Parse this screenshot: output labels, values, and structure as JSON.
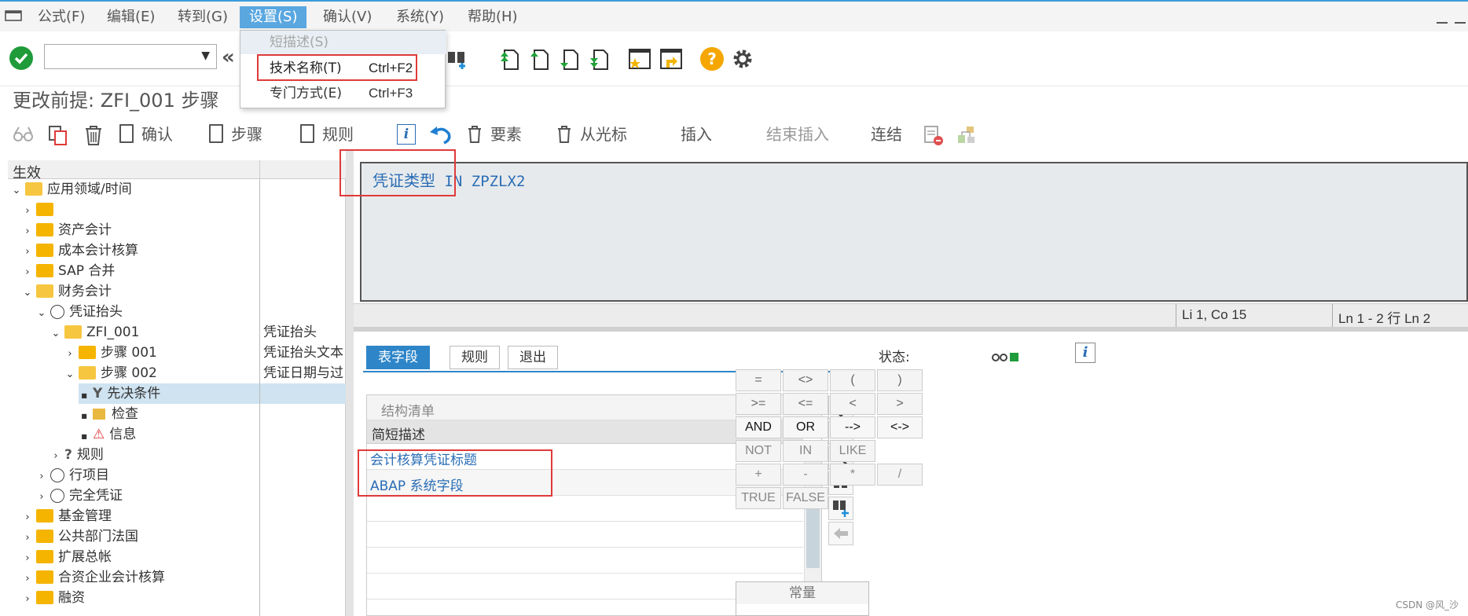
{
  "menubar": {
    "items": [
      {
        "label": "公式(F)"
      },
      {
        "label": "编辑(E)"
      },
      {
        "label": "转到(G)"
      },
      {
        "label": "设置(S)"
      },
      {
        "label": "确认(V)"
      },
      {
        "label": "系统(Y)"
      },
      {
        "label": "帮助(H)"
      }
    ]
  },
  "settings_menu": {
    "items": [
      {
        "label": "短描述(S)",
        "shortcut": ""
      },
      {
        "label": "技术名称(T)",
        "shortcut": "Ctrl+F2"
      },
      {
        "label": "专门方式(E)",
        "shortcut": "Ctrl+F3"
      }
    ]
  },
  "page": {
    "title": "更改前提: ZFI_001 步骤"
  },
  "app_toolbar": {
    "confirm": "确认",
    "step": "步骤",
    "rule": "规则",
    "element": "要素",
    "from_cursor": "从光标",
    "insert": "插入",
    "end_insert": "结束插入",
    "link": "连结"
  },
  "tree": {
    "header": "生效",
    "nodes": [
      {
        "label": "应用领域/时间",
        "desc": ""
      },
      {
        "label": "",
        "desc": ""
      },
      {
        "label": "资产会计",
        "desc": ""
      },
      {
        "label": "成本会计核算",
        "desc": ""
      },
      {
        "label": "SAP 合并",
        "desc": ""
      },
      {
        "label": "财务会计",
        "desc": ""
      },
      {
        "label": "凭证抬头",
        "desc": ""
      },
      {
        "label": "ZFI_001",
        "desc": "凭证抬头"
      },
      {
        "label": "步骤 001",
        "desc": "凭证抬头文本"
      },
      {
        "label": "步骤 002",
        "desc": "凭证日期与过"
      },
      {
        "label": "先决条件",
        "desc": ""
      },
      {
        "label": "检查",
        "desc": ""
      },
      {
        "label": "信息",
        "desc": ""
      },
      {
        "label": "规则",
        "desc": ""
      },
      {
        "label": "行项目",
        "desc": ""
      },
      {
        "label": "完全凭证",
        "desc": ""
      },
      {
        "label": "基金管理",
        "desc": ""
      },
      {
        "label": "公共部门法国",
        "desc": ""
      },
      {
        "label": "扩展总帐",
        "desc": ""
      },
      {
        "label": "合资企业会计核算",
        "desc": ""
      },
      {
        "label": "融资",
        "desc": ""
      }
    ]
  },
  "editor": {
    "field": "凭证类型",
    "rest": " IN ZPZLX2"
  },
  "statusline": {
    "position": "Li 1, Co 15",
    "lines": "Ln 1 - 2 行 Ln 2"
  },
  "tabs": [
    {
      "label": "表字段"
    },
    {
      "label": "规则"
    },
    {
      "label": "退出"
    }
  ],
  "structure": {
    "title": "结构清单",
    "column": "简短描述",
    "rows": [
      "会计核算凭证标题",
      "ABAP 系统字段"
    ]
  },
  "operators": {
    "status_label": "状态:",
    "buttons": [
      "=",
      "<>",
      "(",
      ")",
      ">=",
      "<=",
      "<",
      ">",
      "AND",
      "OR",
      "-->",
      "<->",
      "NOT",
      "IN",
      "LIKE",
      "+",
      "-",
      "*",
      "/",
      "TRUE",
      "FALSE"
    ],
    "constants": "常量"
  },
  "watermark": "CSDN @风_沙",
  "colors": {
    "accent": "#2e86c9",
    "highlight_box": "#e03a3a",
    "ok_green": "#1f9b3a"
  }
}
